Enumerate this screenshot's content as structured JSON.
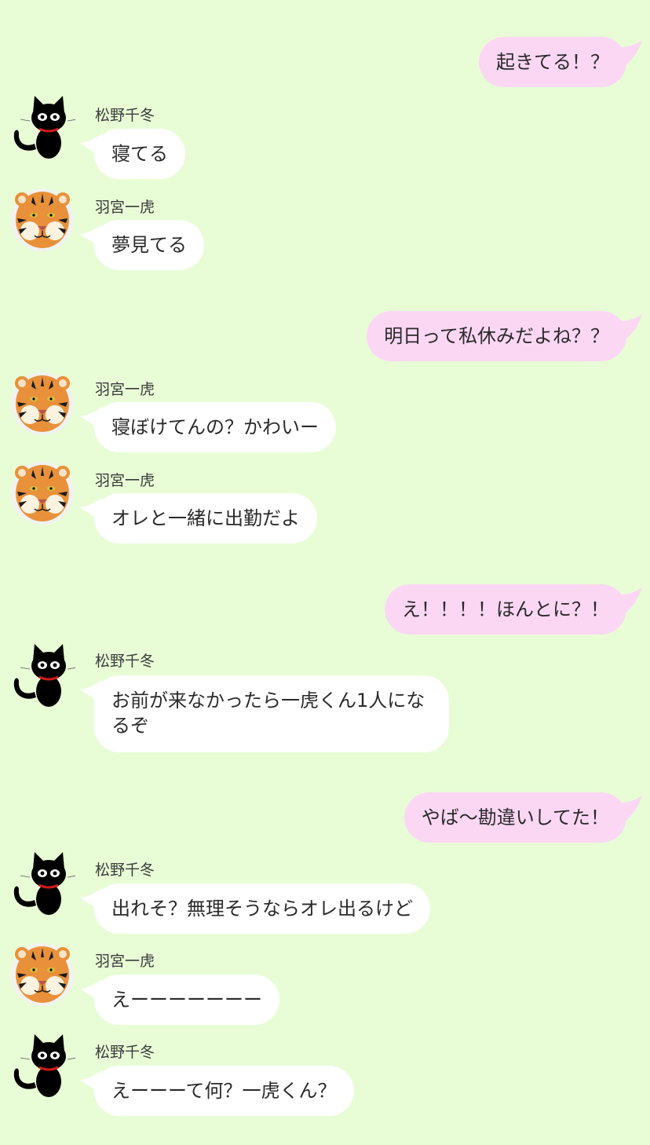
{
  "theme": {
    "background": "#e8fdd6",
    "incoming_bubble": "#ffffff",
    "outgoing_bubble": "#fbd7f4"
  },
  "participants": {
    "cat": {
      "name": "松野千冬",
      "avatar_icon": "black-cat-icon"
    },
    "tiger": {
      "name": "羽宮一虎",
      "avatar_icon": "tiger-icon"
    }
  },
  "messages": [
    {
      "side": "out",
      "text": "起きてる！？"
    },
    {
      "side": "in",
      "sender": "松野千冬",
      "text": "寝てる"
    },
    {
      "side": "in",
      "sender": "羽宮一虎",
      "text": "夢見てる"
    },
    {
      "side": "out",
      "text": "明日って私休みだよね？？"
    },
    {
      "side": "in",
      "sender": "羽宮一虎",
      "text": "寝ぼけてんの？かわいー"
    },
    {
      "side": "in",
      "sender": "羽宮一虎",
      "text": "オレと一緒に出勤だよ"
    },
    {
      "side": "out",
      "text": "え！！！！ほんとに？！"
    },
    {
      "side": "in",
      "sender": "松野千冬",
      "text": "お前が来なかったら一虎くん1人になるぞ"
    },
    {
      "side": "out",
      "text": "やば〜勘違いしてた！"
    },
    {
      "side": "in",
      "sender": "松野千冬",
      "text": "出れそ？無理そうならオレ出るけど"
    },
    {
      "side": "in",
      "sender": "羽宮一虎",
      "text": "えーーーーーーー"
    },
    {
      "side": "in",
      "sender": "松野千冬",
      "text": "えーーーて何？一虎くん？"
    }
  ]
}
